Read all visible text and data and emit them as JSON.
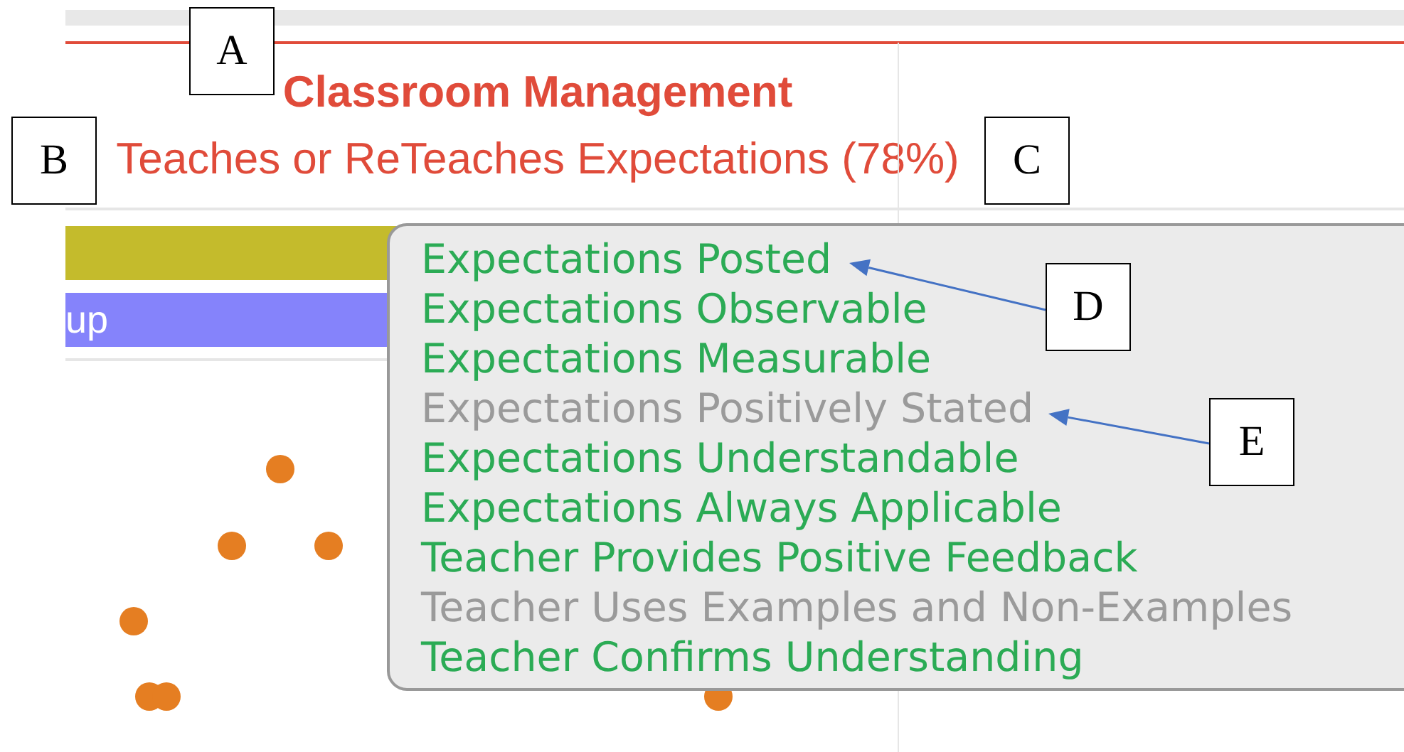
{
  "chart": {
    "title": "Classroom Management",
    "subtitle": "Teaches or ReTeaches Expectations (78%)",
    "bars": [
      {
        "color": "#c4bb2c"
      },
      {
        "color": "#8583fb",
        "label": "up"
      }
    ]
  },
  "tooltip": {
    "items": [
      {
        "text": "Expectations Posted",
        "met": true
      },
      {
        "text": "Expectations Observable",
        "met": true
      },
      {
        "text": "Expectations Measurable",
        "met": true
      },
      {
        "text": "Expectations Positively Stated",
        "met": false
      },
      {
        "text": "Expectations Understandable",
        "met": true
      },
      {
        "text": "Expectations Always Applicable",
        "met": true
      },
      {
        "text": "Teacher Provides Positive Feedback",
        "met": true
      },
      {
        "text": "Teacher Uses Examples and Non-Examples",
        "met": false
      },
      {
        "text": "Teacher Confirms Understanding",
        "met": true
      }
    ]
  },
  "annotations": [
    {
      "label": "A",
      "arrow": false
    },
    {
      "label": "B",
      "arrow": false
    },
    {
      "label": "C",
      "arrow": false
    },
    {
      "label": "D",
      "arrow": true
    },
    {
      "label": "E",
      "arrow": true
    }
  ]
}
